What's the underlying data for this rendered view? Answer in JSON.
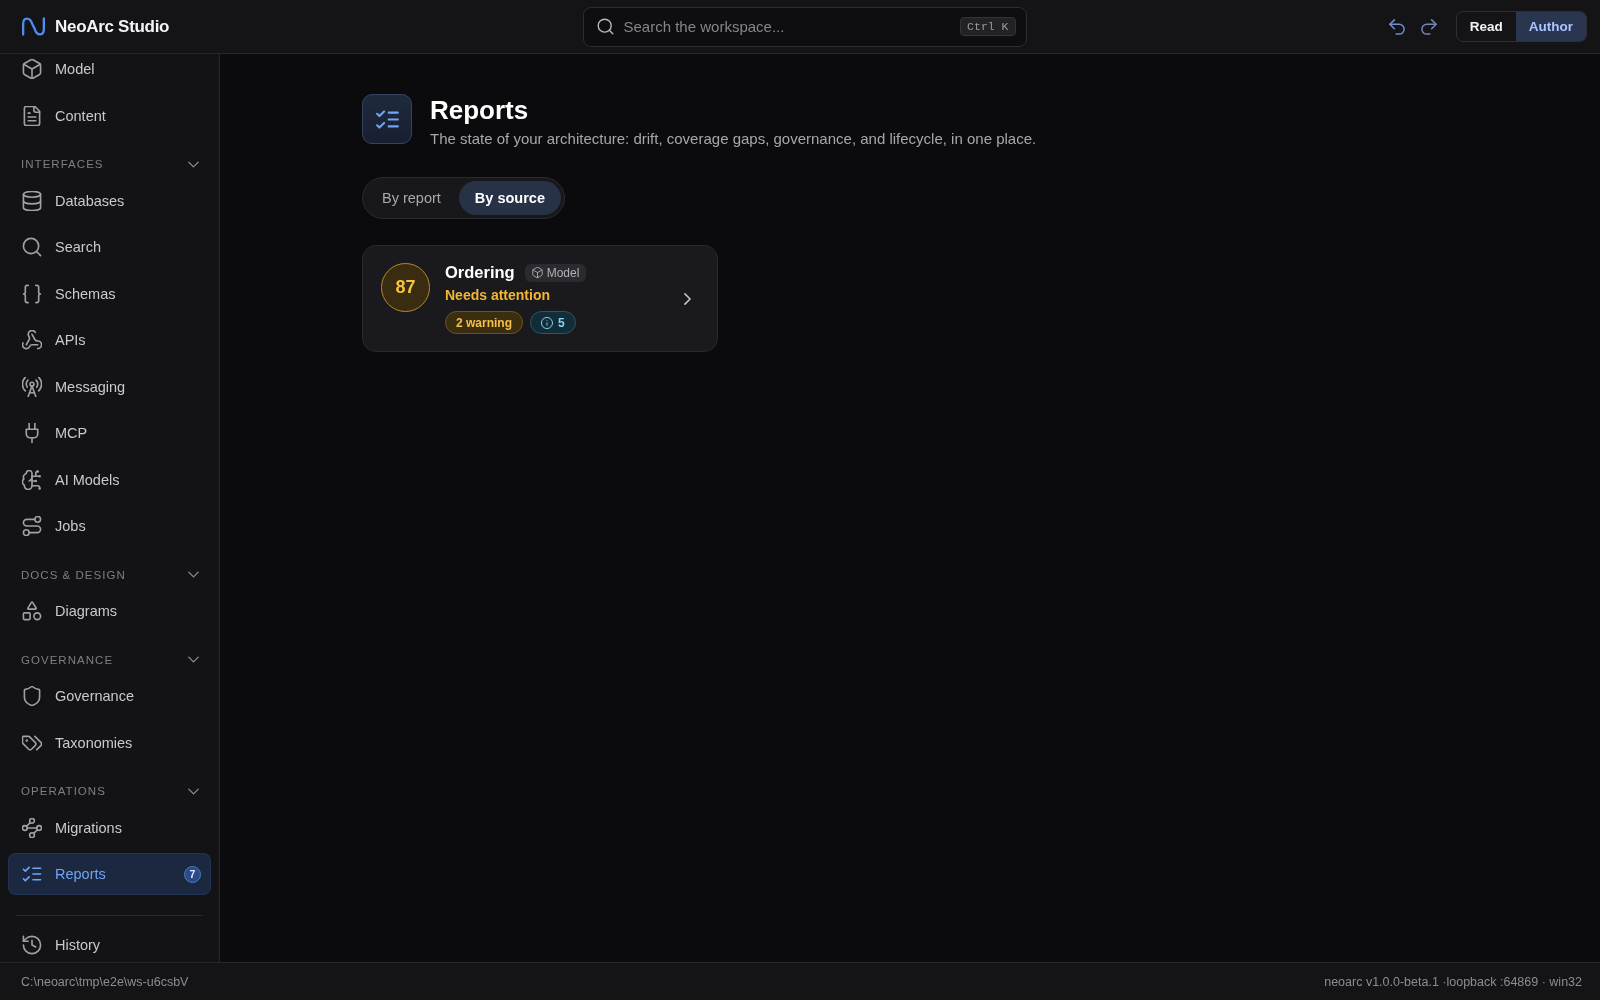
{
  "app": {
    "title": "NeoArc Studio"
  },
  "search": {
    "placeholder": "Search the workspace...",
    "shortcut": "Ctrl K"
  },
  "mode_toggle": [
    {
      "label": "Read",
      "selected": false
    },
    {
      "label": "Author",
      "selected": true
    }
  ],
  "sidebar": {
    "sections": [
      {
        "items": [
          {
            "label": "Model",
            "selected": false
          },
          {
            "label": "Content",
            "selected": false
          }
        ]
      },
      {
        "heading": "INTERFACES",
        "expanded": true,
        "items": [
          {
            "label": "Databases",
            "selected": false
          },
          {
            "label": "Search",
            "selected": false
          },
          {
            "label": "Schemas",
            "selected": false
          },
          {
            "label": "APIs",
            "selected": false
          },
          {
            "label": "Messaging",
            "selected": false
          },
          {
            "label": "MCP",
            "selected": false
          },
          {
            "label": "AI Models",
            "selected": false
          },
          {
            "label": "Jobs",
            "selected": false
          }
        ]
      },
      {
        "heading": "DOCS & DESIGN",
        "expanded": true,
        "items": [
          {
            "label": "Diagrams",
            "selected": false
          }
        ]
      },
      {
        "heading": "GOVERNANCE",
        "expanded": true,
        "items": [
          {
            "label": "Governance",
            "selected": false
          },
          {
            "label": "Taxonomies",
            "selected": false
          }
        ]
      },
      {
        "heading": "OPERATIONS",
        "expanded": true,
        "items": [
          {
            "label": "Migrations",
            "selected": false
          },
          {
            "label": "Reports",
            "selected": true,
            "badge": "7"
          }
        ]
      }
    ],
    "footer_items": [
      {
        "label": "History",
        "selected": false
      }
    ]
  },
  "page": {
    "title": "Reports",
    "subtitle": "The state of your architecture: drift, coverage gaps, governance, and lifecycle, in one place.",
    "view_tabs": [
      {
        "label": "By report",
        "selected": false
      },
      {
        "label": "By source",
        "selected": true
      }
    ],
    "cards": [
      {
        "score": "87",
        "title": "Ordering",
        "source": "Model",
        "status": "Needs attention",
        "badges": [
          {
            "kind": "warning",
            "label": "2 warning"
          },
          {
            "kind": "info",
            "label": "5"
          }
        ]
      }
    ]
  },
  "status_bar": {
    "path": "C:\\neoarc\\tmp\\e2e\\ws-u6csbV",
    "version": "neoarc v1.0.0-beta.1 ·loopback :64869 · win32"
  }
}
